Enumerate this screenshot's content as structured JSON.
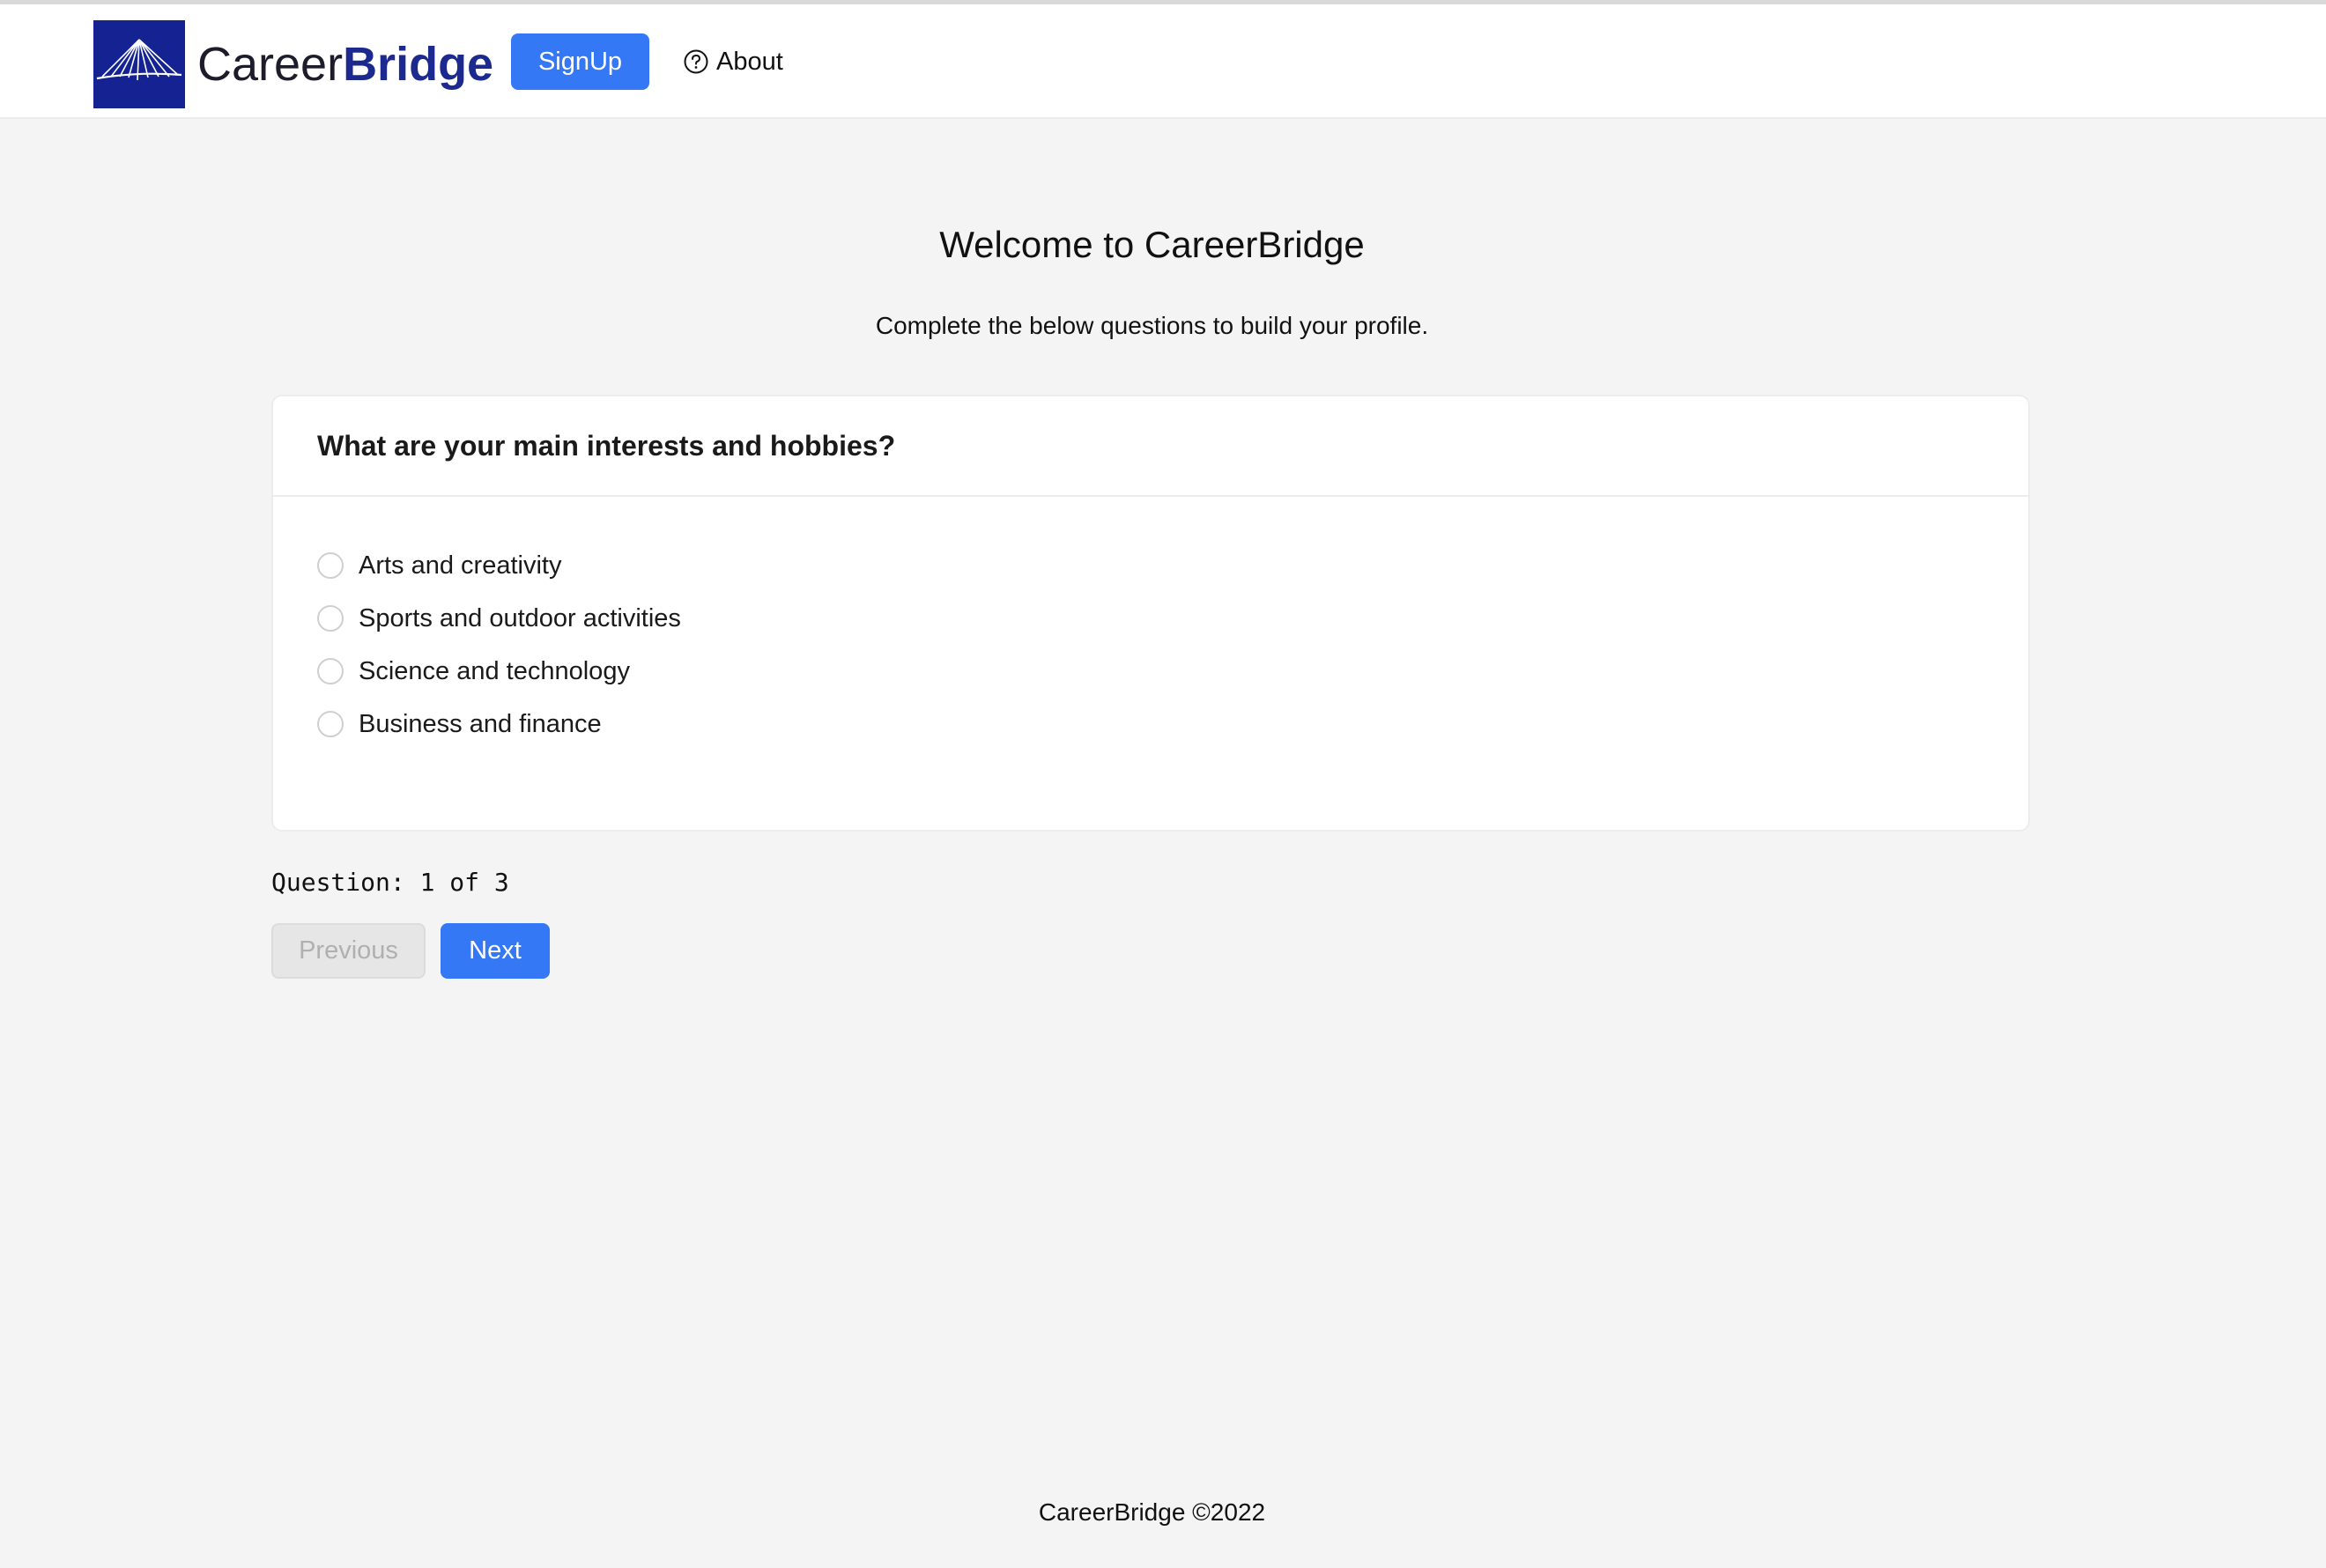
{
  "header": {
    "brand_part1": "Career",
    "brand_part2": "Bridge",
    "signup_label": "SignUp",
    "about_label": "About",
    "logo_icon": "bridge-logo-icon",
    "about_icon": "question-circle-icon"
  },
  "main": {
    "title": "Welcome to CareerBridge",
    "subtitle": "Complete the below questions to build your profile."
  },
  "question": {
    "text": "What are your main interests and hobbies?",
    "options": [
      "Arts and creativity",
      "Sports and outdoor activities",
      "Science and technology",
      "Business and finance"
    ],
    "selected": null
  },
  "progress": {
    "text": "Question: 1 of 3",
    "current": 1,
    "total": 3
  },
  "navigation": {
    "previous_label": "Previous",
    "previous_disabled": true,
    "next_label": "Next"
  },
  "footer": {
    "text": "CareerBridge ©2022"
  },
  "colors": {
    "accent": "#3478f6",
    "brand_blue": "#142391",
    "page_bg": "#f4f4f4"
  }
}
